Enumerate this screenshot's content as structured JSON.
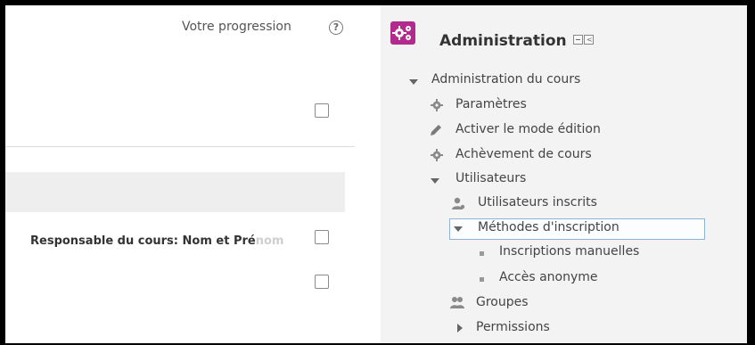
{
  "main": {
    "progress_label": "Votre progression",
    "help_symbol": "?",
    "responsable_text": "Responsable du cours: Nom et Pré",
    "responsable_faded": "nom"
  },
  "admin_block": {
    "title": "Administration",
    "brand_color": "#b22a8c",
    "items": [
      {
        "label": "Administration du cours",
        "icon": "triangle-down-icon"
      },
      {
        "label": "Paramètres",
        "icon": "gear-icon"
      },
      {
        "label": "Activer le mode édition",
        "icon": "pencil-icon"
      },
      {
        "label": "Achèvement de cours",
        "icon": "gear-icon"
      },
      {
        "label": "Utilisateurs",
        "icon": "triangle-down-icon"
      },
      {
        "label": "Utilisateurs inscrits",
        "icon": "user-icon"
      },
      {
        "label": "Méthodes d'inscription",
        "icon": "triangle-down-icon"
      },
      {
        "label": "Inscriptions manuelles",
        "icon": "bullet-icon"
      },
      {
        "label": "Accès anonyme",
        "icon": "bullet-icon"
      },
      {
        "label": "Groupes",
        "icon": "group-icon"
      },
      {
        "label": "Permissions",
        "icon": "triangle-right-icon"
      }
    ]
  }
}
